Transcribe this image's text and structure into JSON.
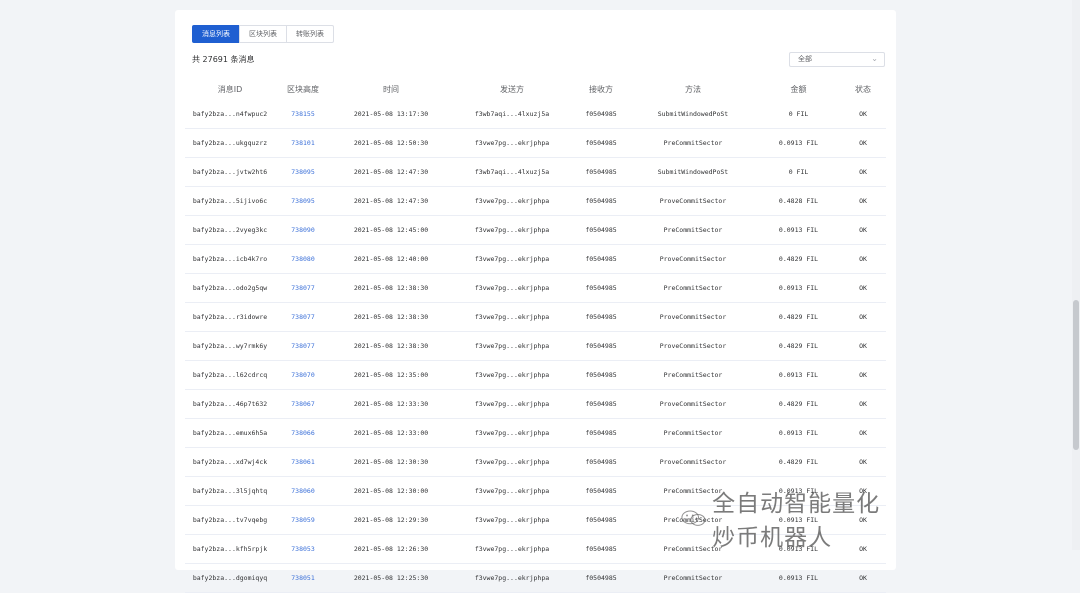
{
  "tabs": [
    {
      "label": "消息列表",
      "active": true
    },
    {
      "label": "区块列表",
      "active": false
    },
    {
      "label": "转账列表",
      "active": false
    }
  ],
  "summary": "共 27691 条消息",
  "filter": {
    "selected": "全部"
  },
  "table": {
    "headers": [
      "消息ID",
      "区块高度",
      "时间",
      "发送方",
      "接收方",
      "方法",
      "金额",
      "状态"
    ],
    "rows": [
      [
        "bafy2bza...n4fwpuc2",
        "738155",
        "2021-05-08 13:17:30",
        "f3wb7aqi...4lxuzj5a",
        "f0504985",
        "SubmitWindowedPoSt",
        "0 FIL",
        "OK"
      ],
      [
        "bafy2bza...ukgquzrz",
        "738101",
        "2021-05-08 12:50:30",
        "f3vwe7pg...ekrjphpa",
        "f0504985",
        "PreCommitSector",
        "0.0913 FIL",
        "OK"
      ],
      [
        "bafy2bza...jvtw2ht6",
        "738095",
        "2021-05-08 12:47:30",
        "f3wb7aqi...4lxuzj5a",
        "f0504985",
        "SubmitWindowedPoSt",
        "0 FIL",
        "OK"
      ],
      [
        "bafy2bza...5ijivo6c",
        "738095",
        "2021-05-08 12:47:30",
        "f3vwe7pg...ekrjphpa",
        "f0504985",
        "ProveCommitSector",
        "0.4828 FIL",
        "OK"
      ],
      [
        "bafy2bza...2vyeg3kc",
        "738090",
        "2021-05-08 12:45:00",
        "f3vwe7pg...ekrjphpa",
        "f0504985",
        "PreCommitSector",
        "0.0913 FIL",
        "OK"
      ],
      [
        "bafy2bza...icb4k7ro",
        "738080",
        "2021-05-08 12:40:00",
        "f3vwe7pg...ekrjphpa",
        "f0504985",
        "ProveCommitSector",
        "0.4829 FIL",
        "OK"
      ],
      [
        "bafy2bza...odo2g5qw",
        "738077",
        "2021-05-08 12:38:30",
        "f3vwe7pg...ekrjphpa",
        "f0504985",
        "PreCommitSector",
        "0.0913 FIL",
        "OK"
      ],
      [
        "bafy2bza...r3idowre",
        "738077",
        "2021-05-08 12:38:30",
        "f3vwe7pg...ekrjphpa",
        "f0504985",
        "ProveCommitSector",
        "0.4829 FIL",
        "OK"
      ],
      [
        "bafy2bza...wy7rmk6y",
        "738077",
        "2021-05-08 12:38:30",
        "f3vwe7pg...ekrjphpa",
        "f0504985",
        "ProveCommitSector",
        "0.4829 FIL",
        "OK"
      ],
      [
        "bafy2bza...l62cdrcq",
        "738070",
        "2021-05-08 12:35:00",
        "f3vwe7pg...ekrjphpa",
        "f0504985",
        "PreCommitSector",
        "0.0913 FIL",
        "OK"
      ],
      [
        "bafy2bza...46p7t632",
        "738067",
        "2021-05-08 12:33:30",
        "f3vwe7pg...ekrjphpa",
        "f0504985",
        "ProveCommitSector",
        "0.4829 FIL",
        "OK"
      ],
      [
        "bafy2bza...emux6h5a",
        "738066",
        "2021-05-08 12:33:00",
        "f3vwe7pg...ekrjphpa",
        "f0504985",
        "PreCommitSector",
        "0.0913 FIL",
        "OK"
      ],
      [
        "bafy2bza...xd7wj4ck",
        "738061",
        "2021-05-08 12:30:30",
        "f3vwe7pg...ekrjphpa",
        "f0504985",
        "ProveCommitSector",
        "0.4829 FIL",
        "OK"
      ],
      [
        "bafy2bza...3l5jqhtq",
        "738060",
        "2021-05-08 12:30:00",
        "f3vwe7pg...ekrjphpa",
        "f0504985",
        "PreCommitSector",
        "0.0913 FIL",
        "OK"
      ],
      [
        "bafy2bza...tv7vqebg",
        "738059",
        "2021-05-08 12:29:30",
        "f3vwe7pg...ekrjphpa",
        "f0504985",
        "PreCommitSector",
        "0.0913 FIL",
        "OK"
      ],
      [
        "bafy2bza...kfh5rpjk",
        "738053",
        "2021-05-08 12:26:30",
        "f3vwe7pg...ekrjphpa",
        "f0504985",
        "PreCommitSector",
        "0.0913 FIL",
        "OK"
      ],
      [
        "bafy2bza...dgomiqyq",
        "738051",
        "2021-05-08 12:25:30",
        "f3vwe7pg...ekrjphpa",
        "f0504985",
        "PreCommitSector",
        "0.0913 FIL",
        "OK"
      ]
    ]
  },
  "watermark": {
    "text": "全自动智能量化炒币机器人",
    "icon": "wechat-icon"
  },
  "colors": {
    "accent": "#1f5fd1",
    "link": "#3a6fd8"
  }
}
